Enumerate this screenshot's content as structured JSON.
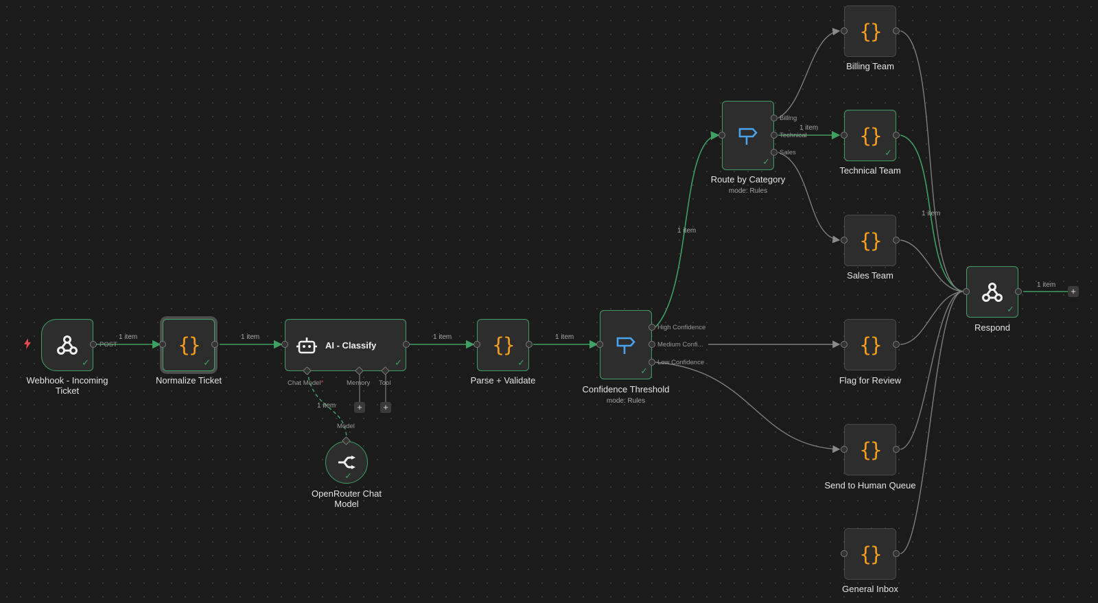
{
  "canvas": {
    "background": "#1b1b1b",
    "accent": "#3fa063",
    "node_icon_braces": "{}"
  },
  "edge_labels": {
    "one_item": "1 item"
  },
  "nodes": {
    "webhook": {
      "label": "Webhook - Incoming Ticket",
      "output": "POST",
      "icon": "webhook-icon"
    },
    "normalize": {
      "label": "Normalize Ticket",
      "icon": "code-braces-icon"
    },
    "ai_classify": {
      "label": "AI - Classify",
      "icon": "robot-icon",
      "ports": {
        "chat_model": "Chat Model",
        "chat_model_required": "*",
        "memory": "Memory",
        "tool": "Tool"
      }
    },
    "openrouter": {
      "label": "OpenRouter Chat Model",
      "input": "Model",
      "icon": "openrouter-icon"
    },
    "parse": {
      "label": "Parse + Validate",
      "icon": "code-braces-icon"
    },
    "confidence": {
      "label": "Confidence Threshold",
      "mode": "mode: Rules",
      "icon": "signpost-icon",
      "outputs": [
        "High Confidence",
        "Medium Confi...",
        "Low Confidence"
      ]
    },
    "route": {
      "label": "Route by Category",
      "mode": "mode: Rules",
      "icon": "signpost-icon",
      "outputs": [
        "Billing",
        "Technical",
        "Sales"
      ]
    },
    "billing": {
      "label": "Billing Team"
    },
    "technical": {
      "label": "Technical Team"
    },
    "sales": {
      "label": "Sales Team"
    },
    "flag": {
      "label": "Flag for Review"
    },
    "human": {
      "label": "Send to Human Queue"
    },
    "general": {
      "label": "General Inbox"
    },
    "respond": {
      "label": "Respond",
      "icon": "webhook-icon"
    }
  },
  "buttons": {
    "add": "+"
  }
}
